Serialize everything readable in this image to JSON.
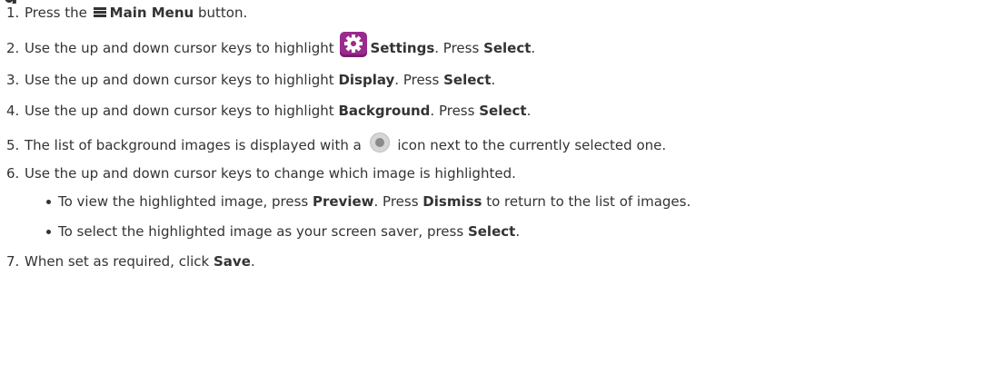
{
  "heading_fragment": "g",
  "steps": {
    "s1": {
      "num": "1.",
      "pre": "Press the",
      "bold": "Main Menu",
      "post": "button."
    },
    "s2": {
      "num": "2.",
      "pre": "Use the up and down cursor keys to highlight",
      "bold": "Settings",
      "mid": ". Press",
      "bold2": "Select",
      "post": "."
    },
    "s3": {
      "num": "3.",
      "pre": "Use the up and down cursor keys to highlight",
      "bold": "Display",
      "mid": ". Press",
      "bold2": "Select",
      "post": "."
    },
    "s4": {
      "num": "4.",
      "pre": "Use the up and down cursor keys to highlight",
      "bold": "Background",
      "mid": ". Press",
      "bold2": "Select",
      "post": "."
    },
    "s5": {
      "num": "5.",
      "pre": "The list of background images is displayed with a",
      "post": "icon next to the currently selected one."
    },
    "s6": {
      "num": "6.",
      "text": "Use the up and down cursor keys to change which image is highlighted.",
      "bullets": [
        {
          "pre": "To view the highlighted image, press",
          "bold": "Preview",
          "mid": ". Press",
          "bold2": "Dismiss",
          "post": "to return to the list of images."
        },
        {
          "pre": "To select the highlighted image as your screen saver, press",
          "bold": "Select",
          "post": "."
        }
      ]
    },
    "s7": {
      "num": "7.",
      "pre": "When set as required, click",
      "bold": "Save",
      "post": "."
    }
  },
  "icons": {
    "menu": "main-menu-icon",
    "settings": "gear-icon",
    "radio": "radio-selected-icon"
  },
  "colors": {
    "text": "#333333",
    "settings_icon": "#9b2a8e",
    "radio_icon": "#8a8a8a"
  }
}
